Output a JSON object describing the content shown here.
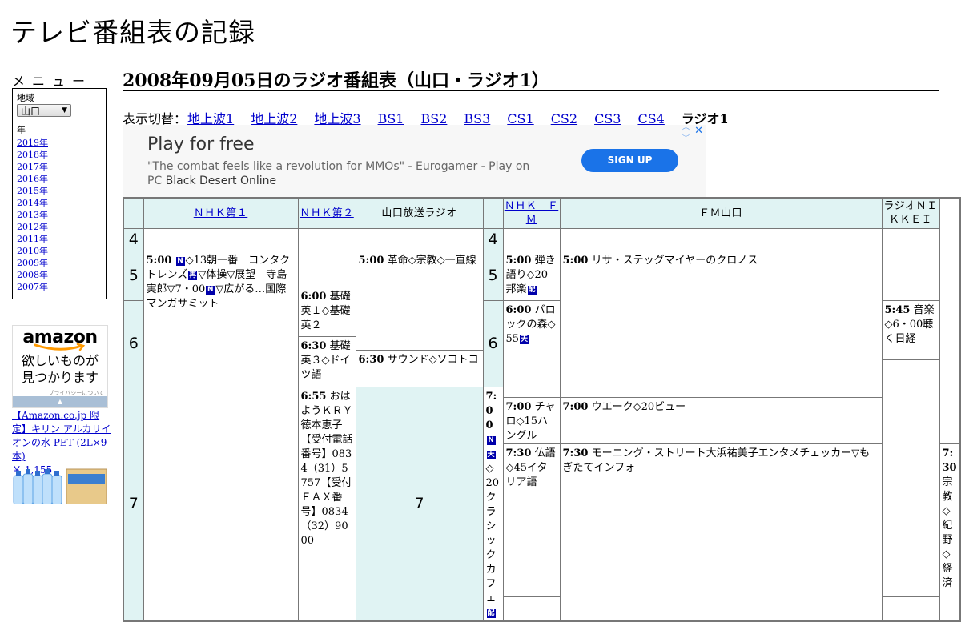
{
  "site": {
    "title": "テレビ番組表の記録"
  },
  "sidebar": {
    "heading": "メニュー",
    "region_label": "地域",
    "region_value": "山口",
    "year_label": "年",
    "years": [
      "2019年",
      "2018年",
      "2017年",
      "2016年",
      "2015年",
      "2014年",
      "2013年",
      "2012年",
      "2011年",
      "2010年",
      "2009年",
      "2008年",
      "2007年"
    ],
    "amazon_ad": {
      "logo": "amazon",
      "tagline_1": "欲しいものが",
      "tagline_2": "見つかります",
      "privacy": "プライバシーについて",
      "bar": "▲",
      "product_text": "【Amazon.co.jp 限定】キリン アルカリイオンの水 PET (2L×9本)",
      "price": "￥ 1,155"
    }
  },
  "main": {
    "title": "2008年09月05日のラジオ番組表（山口・ラジオ1）",
    "switcher_label": "表示切替：",
    "switcher": [
      {
        "label": "地上波1",
        "current": false
      },
      {
        "label": "地上波2",
        "current": false
      },
      {
        "label": "地上波3",
        "current": false
      },
      {
        "label": "BS1",
        "current": false
      },
      {
        "label": "BS2",
        "current": false
      },
      {
        "label": "BS3",
        "current": false
      },
      {
        "label": "CS1",
        "current": false
      },
      {
        "label": "CS2",
        "current": false
      },
      {
        "label": "CS3",
        "current": false
      },
      {
        "label": "CS4",
        "current": false
      },
      {
        "label": "ラジオ1",
        "current": true
      }
    ]
  },
  "ad_banner": {
    "headline": "Play for free",
    "desc": "\"The combat feels like a revolution for MMOs\" - Eurogamer - Play on PC",
    "desc_em": "Black Desert Online",
    "cta": "SIGN UP",
    "info_icon": "ⓘ",
    "close_icon": "✕"
  },
  "schedule": {
    "channels": [
      "ＮＨＫ第１",
      "ＮＨＫ第２",
      "山口放送ラジオ",
      "ＮＨＫ　ＦＭ",
      "ＦＭ山口",
      "ラジオＮＩＫＫＥＩ"
    ],
    "hours": [
      "4",
      "5",
      "6",
      "7"
    ],
    "programs": {
      "nhk1_0500": {
        "time": "5:00",
        "title_a": "◇13朝一番　コンタクトレンズ",
        "title_b": "▽体操▽展望　寺島実郎▽7・00",
        "title_c": "▽広がる…国際マンガサミット"
      },
      "nhk2_0600": {
        "time": "6:00",
        "title": "基礎英１◇基礎英２"
      },
      "nhk2_0630": {
        "time": "6:30",
        "title": "基礎英３◇ドイツ語"
      },
      "nhk2_0700": {
        "time": "7:00",
        "title": "チャロ◇15ハングル"
      },
      "nhk2_0730": {
        "time": "7:30",
        "title": "仏語◇45イタリア語"
      },
      "kry_0500": {
        "time": "5:00",
        "title": "革命◇宗教◇一直線"
      },
      "kry_0630": {
        "time": "6:30",
        "title": "サウンド◇ソコトコ"
      },
      "kry_0655": {
        "time": "6:55",
        "title": "おはようＫＲＹ徳本恵子【受付電話番号】0834（31）5757【受付ＦＡＸ番号】0834（32）9000"
      },
      "nhkfm_0500": {
        "time": "5:00",
        "title": "弾き語り◇20邦楽"
      },
      "nhkfm_0600": {
        "time": "6:00",
        "title": "バロックの森◇55"
      },
      "nhkfm_0700": {
        "time": "7:00",
        "title": "◇20クラシックカフェ"
      },
      "fmy_0500": {
        "time": "5:00",
        "title": "リサ・ステッグマイヤーのクロノス"
      },
      "fmy_0700": {
        "time": "7:00",
        "title": "ウエーク◇20ビュー"
      },
      "fmy_0730": {
        "time": "7:30",
        "title": "モーニング・ストリート大浜祐美子エンタメチェッカー▽もぎたてインフォ"
      },
      "nikkei_0545": {
        "time": "5:45",
        "title": "音楽◇6・00聴く日経"
      },
      "nikkei_0730": {
        "time": "7:30",
        "title": "宗教◇紀野◇経済"
      }
    },
    "marks": {
      "n": "N",
      "sai": "再",
      "ten": "天",
      "hi": "配"
    }
  }
}
